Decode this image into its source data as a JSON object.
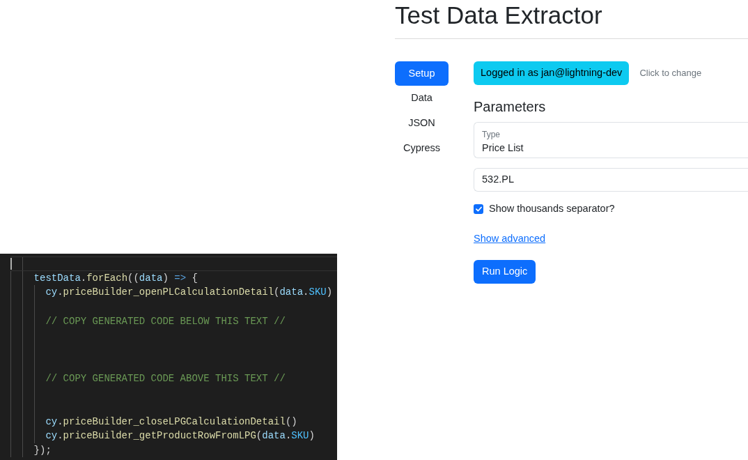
{
  "editor": {
    "lines": [
      {
        "kind": "blank",
        "current": true
      },
      {
        "kind": "code",
        "current": false,
        "tokens": [
          {
            "text": "testData",
            "kind": "variable"
          },
          {
            "text": ".",
            "kind": "punctuation"
          },
          {
            "text": "forEach",
            "kind": "function"
          },
          {
            "text": "((",
            "kind": "punctuation"
          },
          {
            "text": "data",
            "kind": "variable"
          },
          {
            "text": ") ",
            "kind": "punctuation"
          },
          {
            "text": "=>",
            "kind": "keyword"
          },
          {
            "text": " {",
            "kind": "punctuation"
          }
        ],
        "children": [
          {
            "kind": "code",
            "current": false,
            "tokens": [
              {
                "text": "cy",
                "kind": "variable"
              },
              {
                "text": ".",
                "kind": "punctuation"
              },
              {
                "text": "priceBuilder_openPLCalculationDetail",
                "kind": "function"
              },
              {
                "text": "(",
                "kind": "punctuation"
              },
              {
                "text": "data",
                "kind": "variable"
              },
              {
                "text": ".",
                "kind": "punctuation"
              },
              {
                "text": "SKU",
                "kind": "constant"
              },
              {
                "text": ")",
                "kind": "punctuation"
              }
            ]
          },
          {
            "kind": "blank",
            "current": false
          },
          {
            "kind": "code",
            "current": false,
            "tokens": [
              {
                "text": "// COPY GENERATED CODE BELOW THIS TEXT //",
                "kind": "comment"
              }
            ]
          },
          {
            "kind": "blank",
            "current": false
          },
          {
            "kind": "blank",
            "current": false
          },
          {
            "kind": "blank",
            "current": false
          },
          {
            "kind": "code",
            "current": false,
            "tokens": [
              {
                "text": "// COPY GENERATED CODE ABOVE THIS TEXT //",
                "kind": "comment"
              }
            ]
          },
          {
            "kind": "blank",
            "current": false
          },
          {
            "kind": "blank",
            "current": false
          },
          {
            "kind": "code",
            "current": false,
            "tokens": [
              {
                "text": "cy",
                "kind": "variable"
              },
              {
                "text": ".",
                "kind": "punctuation"
              },
              {
                "text": "priceBuilder_closeLPGCalculationDetail",
                "kind": "function"
              },
              {
                "text": "()",
                "kind": "punctuation"
              }
            ]
          },
          {
            "kind": "code",
            "current": false,
            "tokens": [
              {
                "text": "cy",
                "kind": "variable"
              },
              {
                "text": ".",
                "kind": "punctuation"
              },
              {
                "text": "priceBuilder_getProductRowFromLPG",
                "kind": "function"
              },
              {
                "text": "(",
                "kind": "punctuation"
              },
              {
                "text": "data",
                "kind": "variable"
              },
              {
                "text": ".",
                "kind": "punctuation"
              },
              {
                "text": "SKU",
                "kind": "constant"
              },
              {
                "text": ")",
                "kind": "punctuation"
              }
            ]
          }
        ]
      },
      {
        "kind": "code",
        "current": false,
        "tokens": [
          {
            "text": "});",
            "kind": "punctuation"
          }
        ]
      }
    ]
  },
  "app": {
    "title": "Test Data Extractor",
    "nav": [
      {
        "label": "Setup",
        "selected": true
      },
      {
        "label": "Data",
        "selected": false
      },
      {
        "label": "JSON",
        "selected": false
      },
      {
        "label": "Cypress",
        "selected": false
      }
    ],
    "login_badge": "Logged in as jan@lightning-dev",
    "change_hint": "Click to change",
    "parameters": {
      "heading": "Parameters",
      "type_select": {
        "label": "Type",
        "value": "Price List"
      },
      "code_field": {
        "value": "532.PL"
      },
      "thousands_checkbox": {
        "label": "Show thousands separator?",
        "checked": true
      },
      "advanced_link": "Show advanced",
      "run_button": "Run Logic"
    }
  }
}
